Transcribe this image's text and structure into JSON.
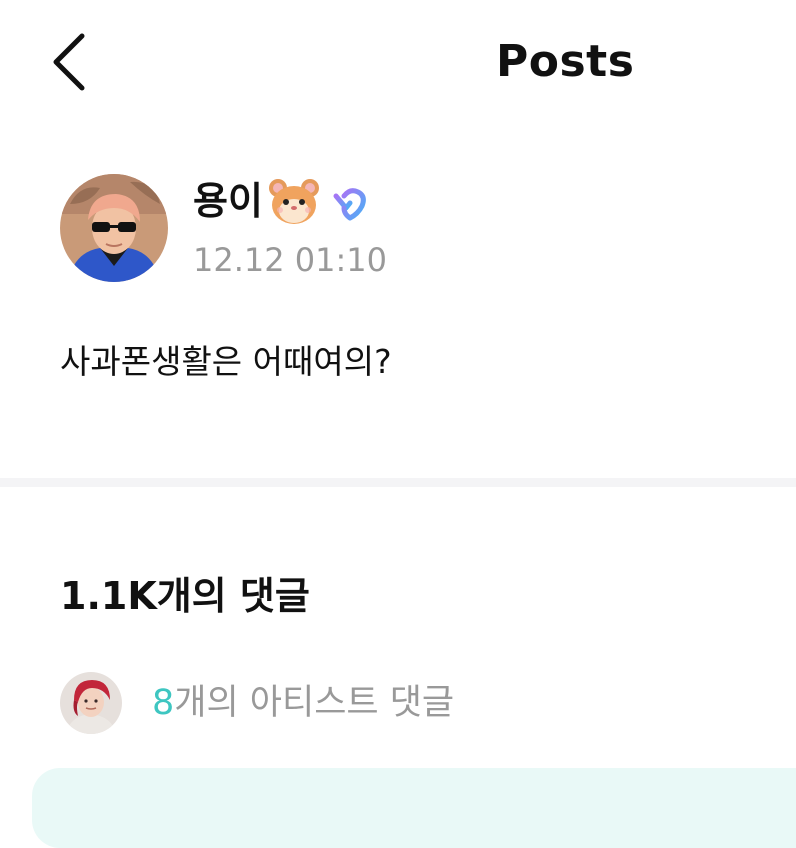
{
  "header": {
    "back_icon": "chevron-left-icon",
    "title": "Posts"
  },
  "post": {
    "author": {
      "name": "용이",
      "emoji_icon": "hamster-face-icon",
      "badge_icon": "verified-heart-icon",
      "avatar_icon": "user-avatar-photo"
    },
    "time": "12.12 01:10",
    "body": "사과폰생활은 어때여의?"
  },
  "comments": {
    "count_label": "1.1K개의 댓글",
    "artist": {
      "avatar_icon": "artist-avatar-photo",
      "count": "8",
      "label": "개의 아티스트 댓글"
    }
  },
  "colors": {
    "accent": "#3ec6c1",
    "muted_text": "#999999",
    "divider": "#f4f4f6",
    "comment_box_bg": "#e9f9f7"
  }
}
